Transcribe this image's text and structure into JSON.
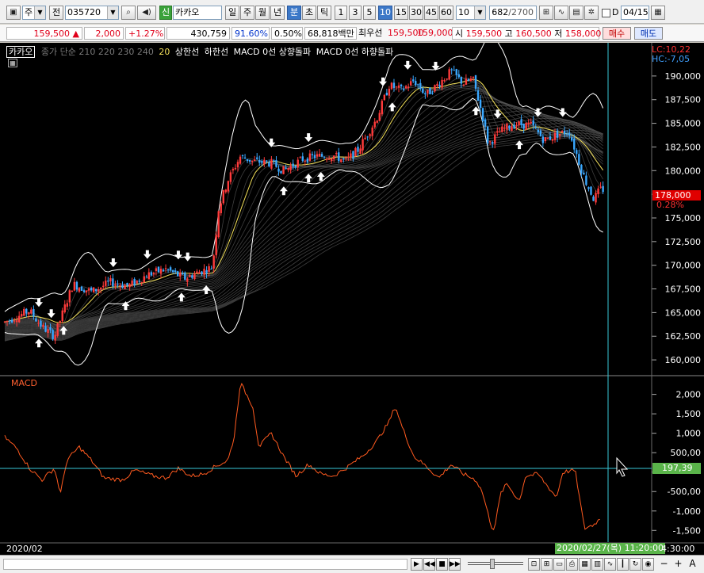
{
  "toolbar": {
    "market": "주",
    "prev_label": "전",
    "stock_code": "035720",
    "stock_flag": "신",
    "stock_name": "카카오",
    "periods": [
      "일",
      "주",
      "월",
      "년",
      "분",
      "초",
      "틱"
    ],
    "active_period": "분",
    "minute_intervals": [
      "1",
      "3",
      "5",
      "10",
      "15",
      "30",
      "45",
      "60"
    ],
    "active_interval": "10",
    "interval_input": "10",
    "count_current": "682",
    "count_total": "/2700",
    "d_checkbox_label": "D",
    "date_value": "04/15"
  },
  "quote": {
    "price": "159,500",
    "change_arrow": "▲",
    "change": "2,000",
    "change_rate": "+1.27%",
    "volume": "430,759",
    "volume_ratio": "91.60%",
    "turnover_pct": "0.50%",
    "trade_value": "68,818백만",
    "optimal_label": "최우선",
    "ask": "159,500",
    "bid": "159,000",
    "open_label": "시",
    "open": "159,500",
    "high_label": "고",
    "high": "160,500",
    "low_label": "저",
    "low": "158,000",
    "buy_label": "매수",
    "sell_label": "매도"
  },
  "legend": {
    "stock": "카카오",
    "ma_label": "종가 단순",
    "ma_periods": [
      "210",
      "220",
      "230",
      "240"
    ],
    "ma20": "20",
    "upper": "상한선",
    "lower": "하한선",
    "macd_up": "MACD 0선 상향돌파",
    "macd_down": "MACD 0선 하향돌파"
  },
  "readouts": {
    "lc": "LC:10,22",
    "hc": "HC:-7,05",
    "last_price": "178,000",
    "last_pct": "0.28%",
    "macd_label": "MACD",
    "macd_value": "197,39",
    "date_left": "2020/02",
    "cursor_time": "2020/02/27(목) 11:20:00",
    "time_right": "4:30:00"
  },
  "chart_data": [
    {
      "type": "candlestick",
      "title": "",
      "y_ticks": [
        160000,
        162500,
        165000,
        167500,
        170000,
        172500,
        175000,
        177500,
        180000,
        182500,
        185000,
        187500,
        190000
      ],
      "y_tick_labels": [
        "160,000",
        "162,500",
        "165,000",
        "167,500",
        "170,000",
        "172,500",
        "175,000",
        "177,500",
        "180,000",
        "182,500",
        "185,000",
        "187,500",
        "190,000"
      ],
      "ylim": [
        158500,
        192000
      ],
      "close_path": [
        [
          0,
          164000
        ],
        [
          0.04,
          165200
        ],
        [
          0.06,
          163500
        ],
        [
          0.08,
          162500
        ],
        [
          0.11,
          168000
        ],
        [
          0.14,
          167200
        ],
        [
          0.17,
          168200
        ],
        [
          0.2,
          167800
        ],
        [
          0.23,
          169000
        ],
        [
          0.26,
          169600
        ],
        [
          0.29,
          168600
        ],
        [
          0.31,
          169200
        ],
        [
          0.335,
          169800
        ],
        [
          0.345,
          176000
        ],
        [
          0.36,
          179000
        ],
        [
          0.38,
          181500
        ],
        [
          0.4,
          181000
        ],
        [
          0.43,
          180800
        ],
        [
          0.45,
          180000
        ],
        [
          0.48,
          181200
        ],
        [
          0.5,
          181500
        ],
        [
          0.53,
          181600
        ],
        [
          0.55,
          181000
        ],
        [
          0.57,
          182200
        ],
        [
          0.6,
          185500
        ],
        [
          0.62,
          189000
        ],
        [
          0.64,
          188500
        ],
        [
          0.66,
          189500
        ],
        [
          0.68,
          188000
        ],
        [
          0.7,
          189200
        ],
        [
          0.72,
          190500
        ],
        [
          0.74,
          189200
        ],
        [
          0.755,
          189700
        ],
        [
          0.77,
          186000
        ],
        [
          0.78,
          182800
        ],
        [
          0.8,
          184200
        ],
        [
          0.82,
          184900
        ],
        [
          0.85,
          184800
        ],
        [
          0.87,
          183200
        ],
        [
          0.89,
          183800
        ],
        [
          0.91,
          184200
        ],
        [
          0.935,
          179200
        ],
        [
          0.95,
          177000
        ],
        [
          0.96,
          178000
        ]
      ],
      "buy_arrows": [
        0.055,
        0.095,
        0.195,
        0.285,
        0.325,
        0.45,
        0.49,
        0.51,
        0.625,
        0.76,
        0.83
      ],
      "sell_arrows": [
        0.055,
        0.075,
        0.175,
        0.23,
        0.28,
        0.295,
        0.43,
        0.49,
        0.61,
        0.65,
        0.695,
        0.795,
        0.86,
        0.9
      ],
      "last_value": 178000,
      "last_pct": "0.28%"
    },
    {
      "type": "line",
      "title": "MACD",
      "y_ticks": [
        -1500,
        -1000,
        -500,
        0,
        500,
        1000,
        1500,
        2000
      ],
      "y_tick_labels": [
        "-1,500",
        "-1,000",
        "-500,00",
        "",
        "500,00",
        "1,000",
        "1,500",
        "2,000"
      ],
      "ylim": [
        -1800,
        2400
      ],
      "series": [
        {
          "name": "MACD",
          "points": [
            [
              0,
              900
            ],
            [
              0.02,
              600
            ],
            [
              0.04,
              100
            ],
            [
              0.06,
              -200
            ],
            [
              0.08,
              100
            ],
            [
              0.09,
              -550
            ],
            [
              0.1,
              300
            ],
            [
              0.12,
              650
            ],
            [
              0.14,
              300
            ],
            [
              0.16,
              -150
            ],
            [
              0.19,
              -200
            ],
            [
              0.21,
              50
            ],
            [
              0.24,
              -100
            ],
            [
              0.26,
              -150
            ],
            [
              0.28,
              100
            ],
            [
              0.3,
              -100
            ],
            [
              0.32,
              -50
            ],
            [
              0.34,
              150
            ],
            [
              0.36,
              300
            ],
            [
              0.37,
              900
            ],
            [
              0.38,
              2300
            ],
            [
              0.4,
              1700
            ],
            [
              0.41,
              650
            ],
            [
              0.43,
              1000
            ],
            [
              0.45,
              400
            ],
            [
              0.47,
              -100
            ],
            [
              0.49,
              200
            ],
            [
              0.51,
              -50
            ],
            [
              0.53,
              -100
            ],
            [
              0.55,
              100
            ],
            [
              0.58,
              450
            ],
            [
              0.6,
              800
            ],
            [
              0.62,
              1300
            ],
            [
              0.63,
              1700
            ],
            [
              0.64,
              1200
            ],
            [
              0.66,
              400
            ],
            [
              0.68,
              150
            ],
            [
              0.7,
              -150
            ],
            [
              0.72,
              200
            ],
            [
              0.74,
              -50
            ],
            [
              0.76,
              -200
            ],
            [
              0.77,
              -500
            ],
            [
              0.785,
              -1400
            ],
            [
              0.79,
              -1450
            ],
            [
              0.8,
              -550
            ],
            [
              0.81,
              -300
            ],
            [
              0.83,
              -750
            ],
            [
              0.84,
              -100
            ],
            [
              0.86,
              -50
            ],
            [
              0.89,
              -650
            ],
            [
              0.9,
              0
            ],
            [
              0.92,
              50
            ],
            [
              0.935,
              -1450
            ],
            [
              0.95,
              -1350
            ],
            [
              0.96,
              -1200
            ]
          ]
        }
      ],
      "last_value": 197.39
    }
  ],
  "bottom": {
    "nav": [
      "▶",
      "◀◀",
      "■",
      "▶▶"
    ],
    "zoom": [
      "−",
      "+",
      "A"
    ]
  }
}
